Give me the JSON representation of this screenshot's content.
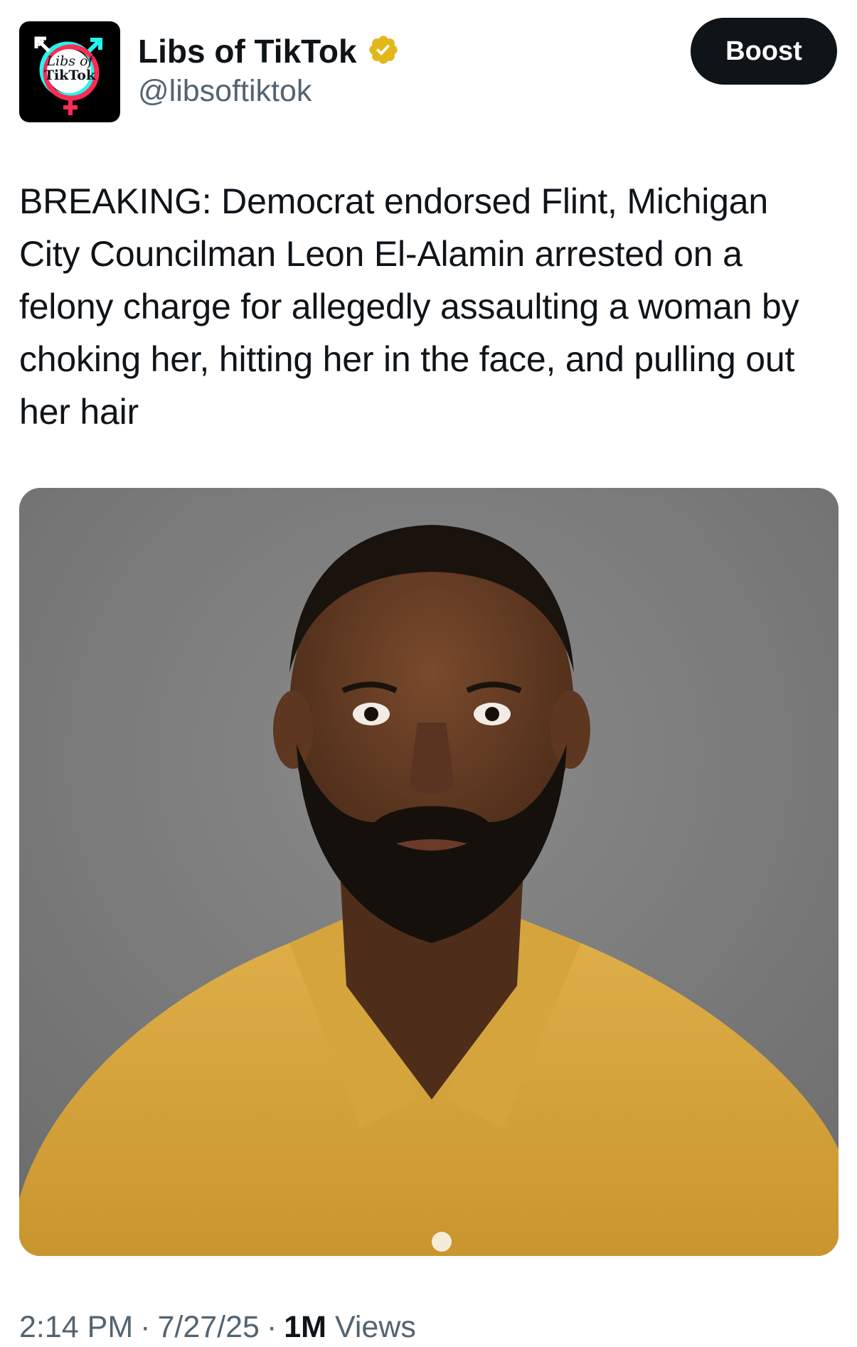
{
  "author": {
    "display_name": "Libs of TikTok",
    "handle": "@libsoftiktok",
    "verified": true,
    "verified_badge_color": "#e2b719",
    "avatar_text_line1": "Libs of",
    "avatar_text_line2": "TikTok",
    "avatar_ring_colors": [
      "#25f4ee",
      "#fe2c55"
    ]
  },
  "actions": {
    "boost_label": "Boost"
  },
  "post": {
    "text": "BREAKING: Democrat endorsed Flint, Michigan City Councilman Leon El-Alamin arrested on a felony charge for allegedly assaulting a woman by choking her, hitting her in the face, and pulling out her hair"
  },
  "media": {
    "kind": "photo",
    "background_color": "#7a7a7a",
    "shirt_color": "#d9a83c"
  },
  "meta": {
    "time": "2:14 PM",
    "date": "7/27/25",
    "views_count": "1M",
    "views_label": "Views",
    "separator": "·"
  }
}
